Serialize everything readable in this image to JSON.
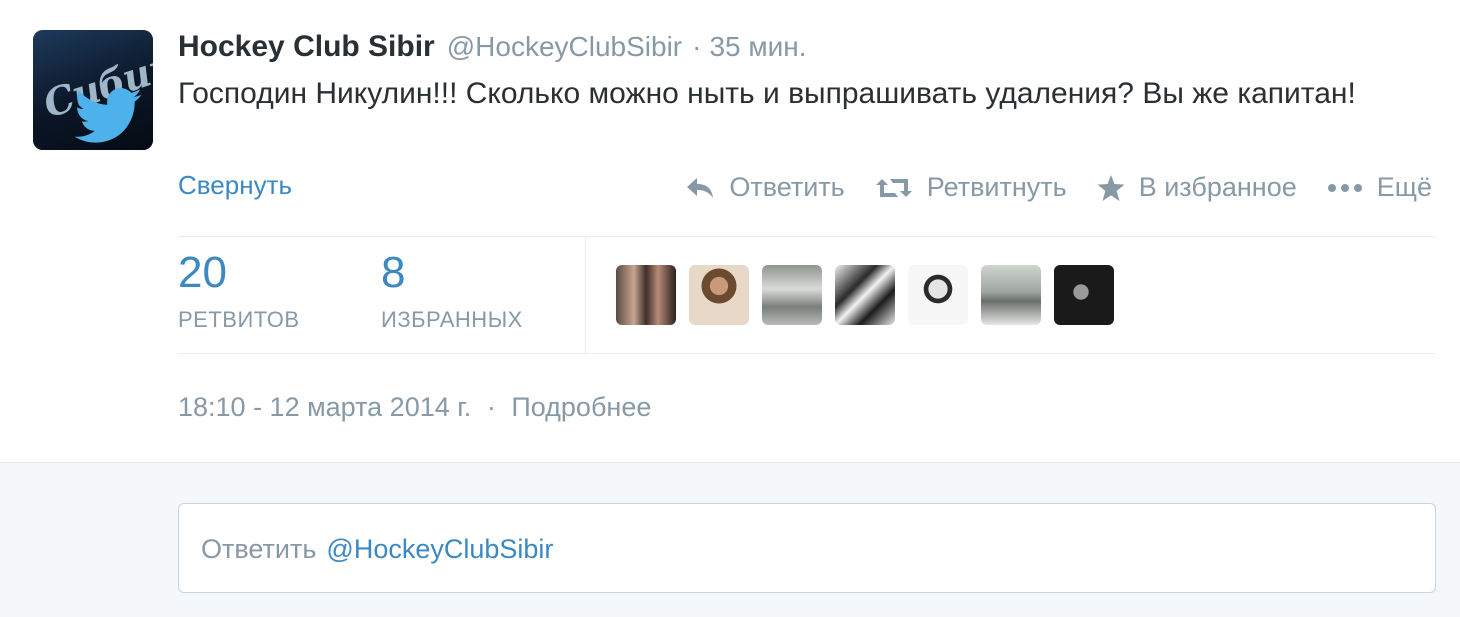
{
  "tweet": {
    "avatar_icon": "twitter-bird-icon",
    "avatar_text": "Сибирь",
    "fullname": "Hockey Club Sibir",
    "username": "@HockeyClubSibir",
    "separator": "·",
    "time": "35 мин.",
    "text": "Господин Никулин!!! Сколько можно ныть и выпрашивать удаления? Вы же капитан!",
    "collapse_label": "Свернуть"
  },
  "actions": {
    "reply_label": "Ответить",
    "retweet_label": "Ретвитнуть",
    "favorite_label": "В избранное",
    "more_label": "Ещё"
  },
  "stats": {
    "retweets": {
      "count": "20",
      "label": "РЕТВИТОВ"
    },
    "favorites": {
      "count": "8",
      "label": "ИЗБРАННЫХ"
    }
  },
  "footer": {
    "timestamp": "18:10 - 12 марта 2014 г.",
    "separator": "·",
    "details_link": "Подробнее"
  },
  "reply": {
    "placeholder_word": "Ответить",
    "placeholder_mention": "@HockeyClubSibir"
  },
  "colors": {
    "link": "#3b88c3",
    "muted": "#8899a6",
    "text": "#292f33"
  }
}
